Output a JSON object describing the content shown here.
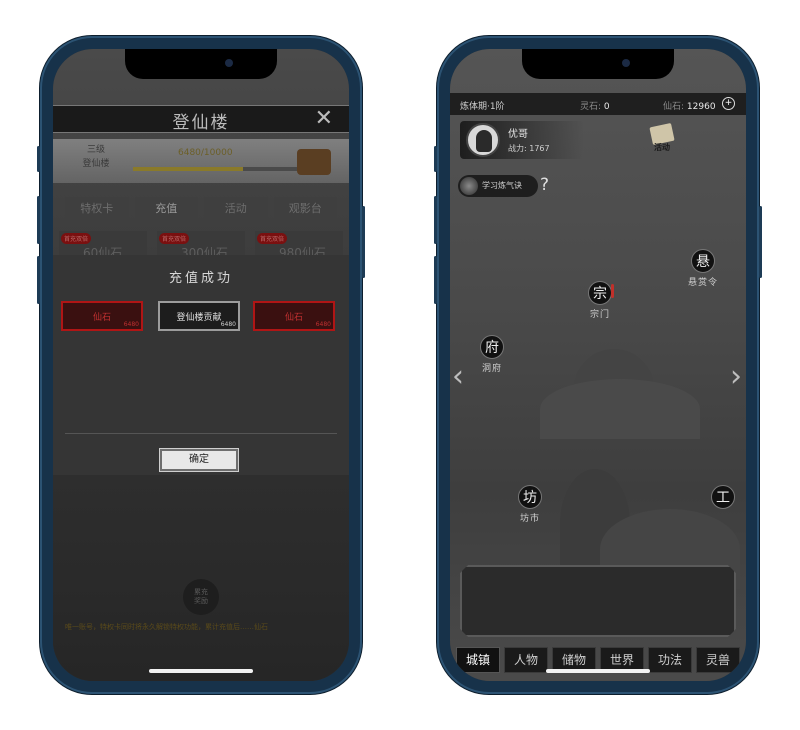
{
  "left": {
    "title": "登仙楼",
    "close_icon": "close-icon",
    "level": "三级\n登仙楼",
    "progress_text": "6480/10000",
    "progress": 0.648,
    "tabs": [
      "特权卡",
      "充值",
      "活动",
      "观影台"
    ],
    "cards": [
      {
        "tag": "首充双倍",
        "amount": "60仙石"
      },
      {
        "tag": "首充双倍",
        "amount": "300仙石"
      },
      {
        "tag": "首充双倍",
        "amount": "980仙石"
      }
    ],
    "dialog": {
      "title": "充值成功",
      "items": [
        {
          "name": "仙石",
          "qty": "6480"
        },
        {
          "name": "登仙楼贡献",
          "qty": "6480"
        },
        {
          "name": "仙石",
          "qty": "6480"
        }
      ],
      "ok_label": "确定"
    },
    "reward_label": "累充\n奖励",
    "marquee": "唯一账号，特权卡同时将永久解锁特权功能，累计充值后……仙石"
  },
  "right": {
    "status": {
      "realm": "炼体期·1阶",
      "lingshi_label": "灵石:",
      "lingshi_value": "0",
      "xianshi_label": "仙石:",
      "xianshi_value": "12960"
    },
    "profile": {
      "name": "优哥",
      "power_label": "战力: 1767"
    },
    "activity_label": "活动",
    "learn_label": "学习炼气诀",
    "learn_hint": "?",
    "nodes": [
      {
        "glyph": "宗",
        "caption": "宗门"
      },
      {
        "glyph": "悬",
        "caption": "悬赏令"
      },
      {
        "glyph": "府",
        "caption": "洞府"
      },
      {
        "glyph": "坊",
        "caption": "坊市"
      },
      {
        "glyph": "工",
        "caption": ""
      }
    ],
    "nav": [
      "城镇",
      "人物",
      "储物",
      "世界",
      "功法",
      "灵兽"
    ],
    "active_nav": "城镇"
  },
  "colors": {
    "accent_red": "#b01515",
    "gold": "#8a7a2a",
    "phone_frame": "#17324a"
  }
}
